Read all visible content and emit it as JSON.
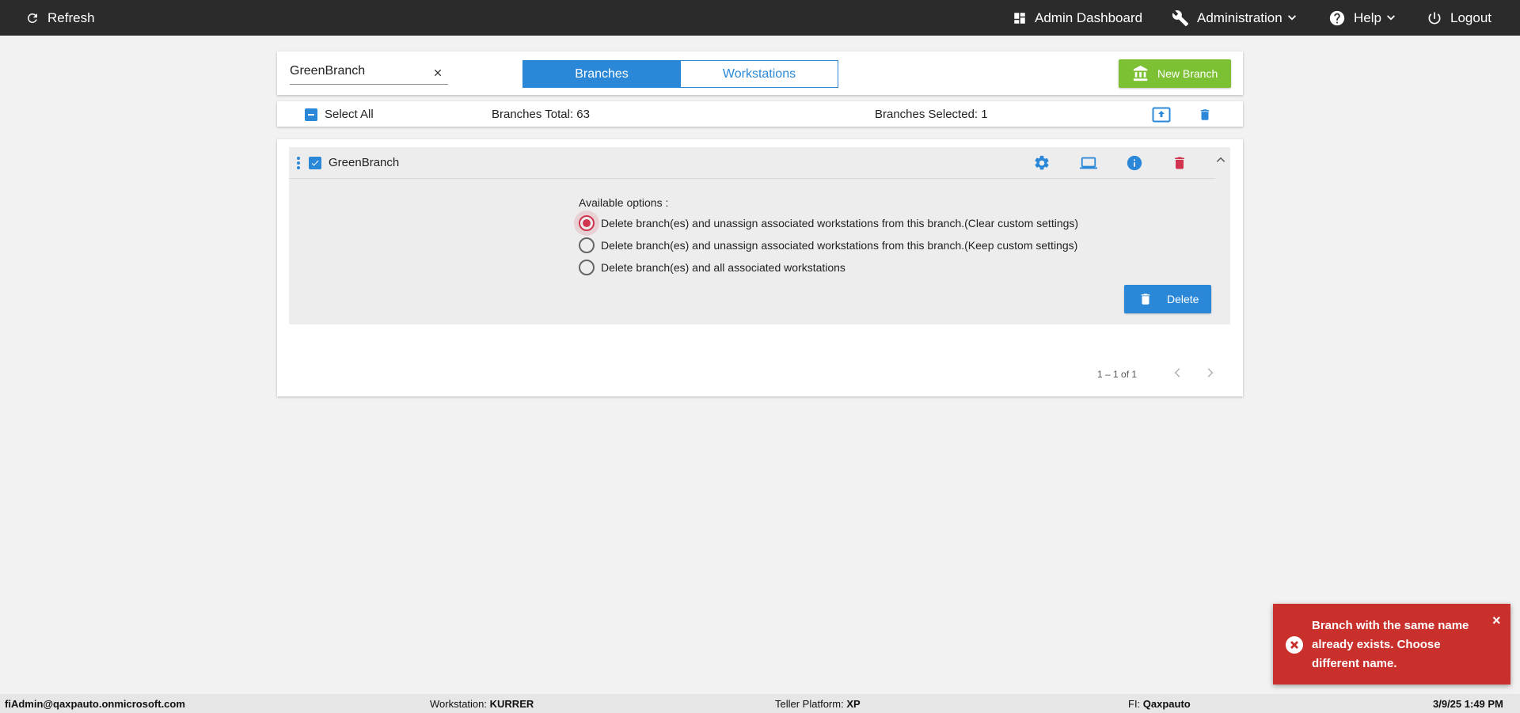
{
  "topbar": {
    "refresh_label": "Refresh",
    "admin_dashboard_label": "Admin Dashboard",
    "administration_label": "Administration",
    "help_label": "Help",
    "logout_label": "Logout"
  },
  "search": {
    "value": "GreenBranch",
    "clear_icon": "close-icon"
  },
  "tabs": {
    "branches_label": "Branches",
    "workstations_label": "Workstations",
    "active": "Branches"
  },
  "new_branch_label": "New Branch",
  "selection": {
    "select_all_label": "Select All",
    "branches_total": "Branches Total: 63",
    "branches_selected": "Branches Selected: 1"
  },
  "branch_row": {
    "name": "GreenBranch",
    "checked": true,
    "icons": [
      "gear-icon",
      "laptop-icon",
      "info-icon",
      "trash-icon",
      "chevron-up-icon"
    ]
  },
  "delete_options": {
    "label": "Available options :",
    "options": [
      "Delete branch(es) and unassign associated workstations from this branch.(Clear custom settings)",
      "Delete branch(es) and unassign associated workstations from this branch.(Keep custom settings)",
      "Delete branch(es) and all associated workstations"
    ],
    "selected_index": 0,
    "delete_label": "Delete"
  },
  "pagination": {
    "text": "1 – 1 of 1"
  },
  "toast": {
    "message": "Branch with the same name already exists. Choose different name.",
    "close_label": "×"
  },
  "statusbar": {
    "user": "fiAdmin@qaxpauto.onmicrosoft.com",
    "workstation_label": "Workstation:",
    "workstation_value": "KURRER",
    "teller_label": "Teller Platform:",
    "teller_value": "XP",
    "fi_label": "FI:",
    "fi_value": "Qaxpauto",
    "datetime": "3/9/25 1:49 PM"
  },
  "colors": {
    "topbar": "#2b2b2b",
    "accent_blue": "#2b88d8",
    "new_branch_green": "#7cc033",
    "danger_red": "#d0344f",
    "toast_red": "#c9302c"
  }
}
